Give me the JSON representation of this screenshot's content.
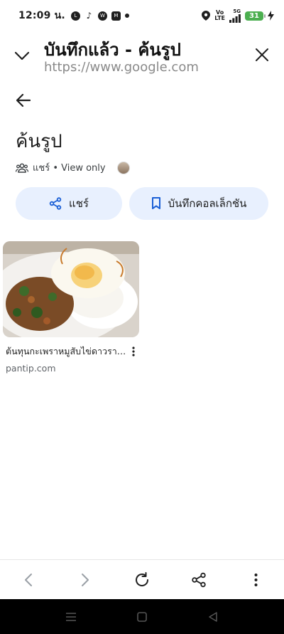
{
  "status_bar": {
    "time": "12:09 น.",
    "notif_icons": [
      "line-icon",
      "tiktok-icon",
      "w-icon",
      "m-icon"
    ],
    "network_label_top": "Vo",
    "network_label_bottom": "LTE",
    "network_gen": "5G",
    "battery_level": "31"
  },
  "header": {
    "title": "บันทึกแล้ว - ค้นรูป",
    "url": "https://www.google.com"
  },
  "page": {
    "title": "ค้นรูป",
    "share_status": "แชร์ • View only"
  },
  "actions": {
    "share_label": "แชร์",
    "save_collection_label": "บันทึกคอลเล็กชัน"
  },
  "items": [
    {
      "title": "ต้นทุนกะเพราหมูสับไข่ดาวราคาเท่าไหร่",
      "source": "pantip.com"
    }
  ],
  "colors": {
    "pill_bg": "#e8f0fe",
    "accent_blue": "#1a5fd6",
    "battery_green": "#4caf50"
  }
}
